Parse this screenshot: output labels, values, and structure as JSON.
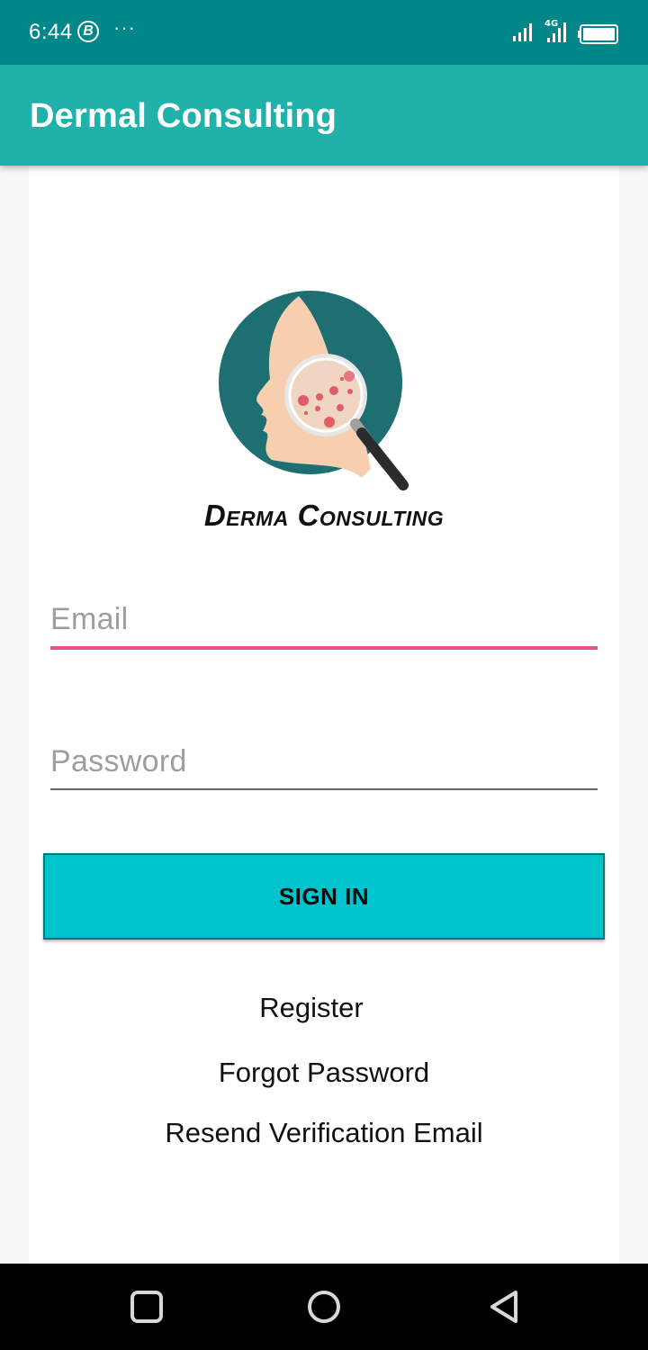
{
  "status_bar": {
    "time": "6:44",
    "b_badge": "B",
    "more": "···",
    "network": "4G"
  },
  "app_bar": {
    "title": "Dermal Consulting"
  },
  "logo": {
    "brand_text": "Derma Consulting"
  },
  "form": {
    "email_placeholder": "Email",
    "password_placeholder": "Password",
    "sign_in_label": "SIGN IN"
  },
  "links": {
    "register": "Register",
    "forgot_password": "Forgot Password",
    "resend_verification": "Resend Verification Email"
  },
  "colors": {
    "status_bar": "#00878a",
    "app_bar": "#20b2aa",
    "button": "#00c4cc",
    "focus_underline": "#e8538f"
  },
  "nav_bar": {
    "icons": [
      "recents-icon",
      "home-icon",
      "back-icon"
    ]
  }
}
